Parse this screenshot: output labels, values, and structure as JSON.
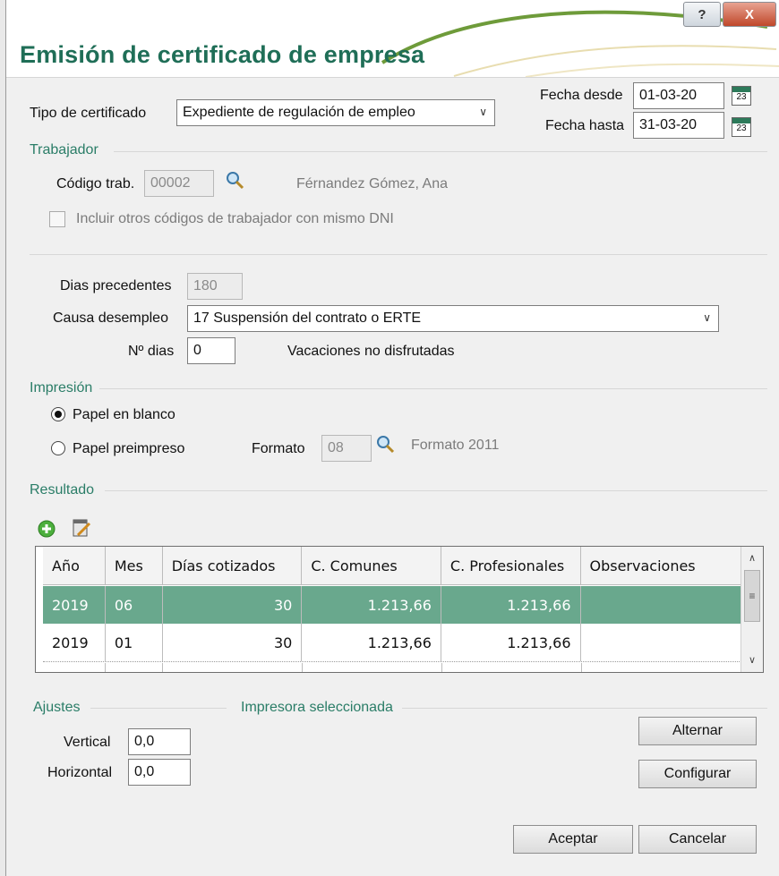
{
  "window": {
    "title": "Emisión de certificado de empresa",
    "help_label": "?",
    "close_label": "X"
  },
  "header": {
    "tipo_label": "Tipo de certificado",
    "tipo_value": "Expediente de regulación de empleo",
    "fecha_desde_label": "Fecha desde",
    "fecha_desde_value": "01-03-20",
    "fecha_hasta_label": "Fecha hasta",
    "fecha_hasta_value": "31-03-20",
    "calendar_day": "23"
  },
  "trabajador": {
    "section": "Trabajador",
    "codigo_label": "Código trab.",
    "codigo_value": "00002",
    "nombre": "Férnandez Gómez, Ana",
    "incluir_label": "Incluir otros códigos de trabajador con mismo DNI",
    "incluir_checked": false
  },
  "detalles": {
    "dias_prec_label": "Dias precedentes",
    "dias_prec_value": "180",
    "causa_label": "Causa  desempleo",
    "causa_value": "17 Suspensión del contrato o ERTE",
    "ndias_label": "Nº dias",
    "ndias_value": "0",
    "vacaciones_label": "Vacaciones no disfrutadas"
  },
  "impresion": {
    "section": "Impresión",
    "papel_blanco": "Papel en blanco",
    "papel_preimpreso": "Papel preimpreso",
    "selected": "Papel en blanco",
    "formato_label": "Formato",
    "formato_value": "08",
    "formato_desc": "Formato 2011"
  },
  "resultado": {
    "section": "Resultado",
    "columns": [
      "Año",
      "Mes",
      "Días cotizados",
      "C. Comunes",
      "C. Profesionales",
      "Observaciones"
    ],
    "rows": [
      {
        "anio": "2019",
        "mes": "06",
        "dias": "30",
        "comunes": "1.213,66",
        "profesionales": "1.213,66",
        "obs": ""
      },
      {
        "anio": "2019",
        "mes": "01",
        "dias": "30",
        "comunes": "1.213,66",
        "profesionales": "1.213,66",
        "obs": ""
      }
    ],
    "selected_row": 0
  },
  "ajustes": {
    "section": "Ajustes",
    "vertical_label": "Vertical",
    "vertical_value": "0,0",
    "horizontal_label": "Horizontal",
    "horizontal_value": "0,0"
  },
  "impresora": {
    "section": "Impresora seleccionada",
    "alternar_label": "Alternar",
    "configurar_label": "Configurar"
  },
  "footer": {
    "aceptar_label": "Aceptar",
    "cancelar_label": "Cancelar"
  },
  "colors": {
    "accent": "#1f6e57",
    "section": "#2a7d67",
    "selected_row": "#69a88d"
  }
}
